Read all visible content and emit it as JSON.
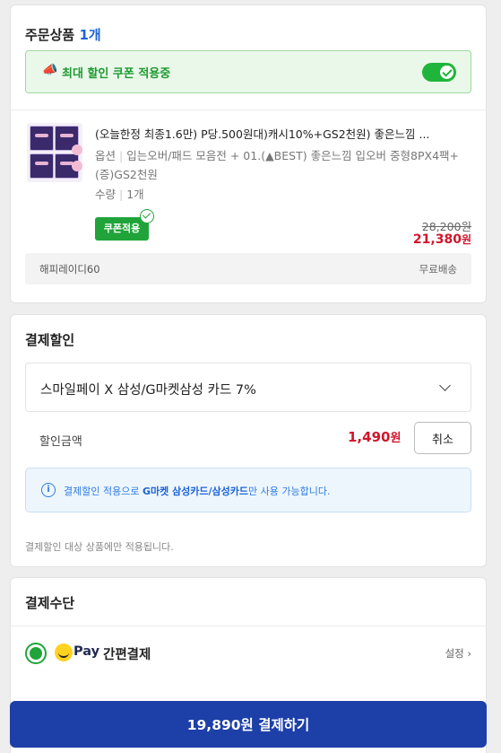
{
  "order": {
    "title": "주문상품",
    "count": "1개",
    "coupon_banner": "최대 할인 쿠폰 적용중",
    "product_name": "(오늘한정 최종1.6만) P당.500원대)캐시10%+GS2천원) 좋은느낌 ...",
    "option_label": "옵션",
    "option_value": "입는오버/패드 모음전 + 01.(▲BEST) 좋은느낌 입오버 중형8PX4팩+(증)GS2천원",
    "qty_label": "수량",
    "qty_value": "1개",
    "coupon_badge": "쿠폰적용",
    "price_original": "28,200원",
    "price_final": "21,380",
    "price_unit": "원",
    "seller": "해피레이디60",
    "shipping": "무료배송"
  },
  "discount": {
    "title": "결제할인",
    "selected_card": "스마일페이 X 삼성/G마켓삼성 카드 7%",
    "amount_label": "할인금액",
    "amount": "1,490",
    "amount_unit": "원",
    "cancel_label": "취소",
    "info_prefix": "결제할인 적용으로 ",
    "info_highlight": "G마켓 삼성카드/삼성카드",
    "info_suffix": "만 사용 가능합니다.",
    "note": "결제할인 대상 상품에만 적용됩니다."
  },
  "payment": {
    "title": "결제수단",
    "pay_logo": "Pay",
    "pay_name": "간편결제",
    "settings_label": "설정 ›"
  },
  "checkout": {
    "button_label": "19,890원 결제하기"
  },
  "colors": {
    "accent_green": "#20a43a",
    "price_red": "#d1162c",
    "link_blue": "#1b63d8",
    "button_navy": "#1d3fa8"
  },
  "icons": {
    "coupon_banner": "megaphone-icon",
    "toggle": "toggle-on-icon",
    "dropdown": "chevron-down-icon",
    "info": "info-icon",
    "smile_pay": "smile-logo-icon"
  }
}
